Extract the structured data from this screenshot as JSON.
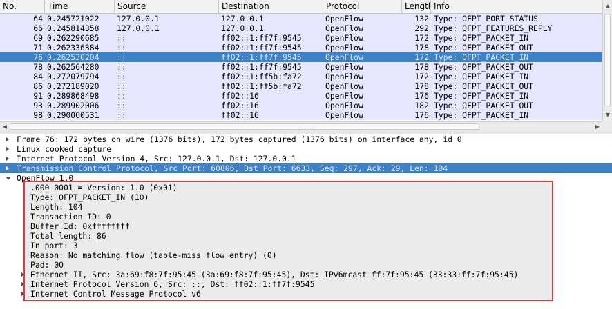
{
  "packet_list": {
    "columns": [
      "No.",
      "Time",
      "Source",
      "Destination",
      "Protocol",
      "Length",
      "Info"
    ],
    "rows": [
      {
        "no": "64",
        "time": "0.245721022",
        "src": "127.0.0.1",
        "dst": "127.0.0.1",
        "proto": "OpenFlow",
        "len": "132",
        "info": "Type: OFPT_PORT_STATUS"
      },
      {
        "no": "66",
        "time": "0.245814358",
        "src": "127.0.0.1",
        "dst": "127.0.0.1",
        "proto": "OpenFlow",
        "len": "292",
        "info": "Type: OFPT_FEATURES_REPLY"
      },
      {
        "no": "69",
        "time": "0.262290685",
        "src": "::",
        "dst": "ff02::1:ff7f:9545",
        "proto": "OpenFlow",
        "len": "172",
        "info": "Type: OFPT_PACKET_IN"
      },
      {
        "no": "71",
        "time": "0.262336384",
        "src": "::",
        "dst": "ff02::1:ff7f:9545",
        "proto": "OpenFlow",
        "len": "178",
        "info": "Type: OFPT_PACKET_OUT"
      },
      {
        "no": "76",
        "time": "0.262530204",
        "src": "::",
        "dst": "ff02::1:ff7f:9545",
        "proto": "OpenFlow",
        "len": "172",
        "info": "Type: OFPT_PACKET_IN"
      },
      {
        "no": "78",
        "time": "0.262564280",
        "src": "::",
        "dst": "ff02::1:ff7f:9545",
        "proto": "OpenFlow",
        "len": "178",
        "info": "Type: OFPT_PACKET_OUT"
      },
      {
        "no": "84",
        "time": "0.272079794",
        "src": "::",
        "dst": "ff02::1:ff5b:fa72",
        "proto": "OpenFlow",
        "len": "172",
        "info": "Type: OFPT_PACKET_IN"
      },
      {
        "no": "86",
        "time": "0.272189020",
        "src": "::",
        "dst": "ff02::1:ff5b:fa72",
        "proto": "OpenFlow",
        "len": "178",
        "info": "Type: OFPT_PACKET_OUT"
      },
      {
        "no": "91",
        "time": "0.289868498",
        "src": "::",
        "dst": "ff02::16",
        "proto": "OpenFlow",
        "len": "176",
        "info": "Type: OFPT_PACKET_IN"
      },
      {
        "no": "93",
        "time": "0.289902006",
        "src": "::",
        "dst": "ff02::16",
        "proto": "OpenFlow",
        "len": "182",
        "info": "Type: OFPT_PACKET_OUT"
      },
      {
        "no": "98",
        "time": "0.290060531",
        "src": "::",
        "dst": "ff02::16",
        "proto": "OpenFlow",
        "len": "176",
        "info": "Type: OFPT_PACKET_IN"
      }
    ],
    "selected_no": "76"
  },
  "details": {
    "rows": [
      {
        "text": "Frame 76: 172 bytes on wire (1376 bits), 172 bytes captured (1376 bits) on interface any, id 0",
        "expander": "collapsed"
      },
      {
        "text": "Linux cooked capture",
        "expander": "collapsed"
      },
      {
        "text": "Internet Protocol Version 4, Src: 127.0.0.1, Dst: 127.0.0.1",
        "expander": "collapsed"
      },
      {
        "text": "Transmission Control Protocol, Src Port: 60806, Dst Port: 6633, Seq: 297, Ack: 29, Len: 104",
        "expander": "collapsed",
        "selected": true
      },
      {
        "text": "OpenFlow 1.0",
        "expander": "expanded"
      },
      {
        "text": ".000 0001 = Version: 1.0 (0x01)"
      },
      {
        "text": "Type: OFPT_PACKET_IN (10)"
      },
      {
        "text": "Length: 104"
      },
      {
        "text": "Transaction ID: 0"
      },
      {
        "text": "Buffer Id: 0xffffffff"
      },
      {
        "text": "Total length: 86"
      },
      {
        "text": "In port: 3"
      },
      {
        "text": "Reason: No matching flow (table-miss flow entry) (0)"
      },
      {
        "text": "Pad: 00"
      },
      {
        "text": "Ethernet II, Src: 3a:69:f8:7f:95:45 (3a:69:f8:7f:95:45), Dst: IPv6mcast_ff:7f:95:45 (33:33:ff:7f:95:45)",
        "expander": "collapsed"
      },
      {
        "text": "Internet Protocol Version 6, Src: ::, Dst: ff02::1:ff7f:9545",
        "expander": "collapsed"
      },
      {
        "text": "Internet Control Message Protocol v6",
        "expander": "collapsed"
      }
    ]
  },
  "icons": {
    "scroll_up": "scroll-up-arrow-icon",
    "scroll_down": "scroll-down-arrow-icon",
    "scroll_left": "scroll-left-arrow-icon",
    "scroll_right": "scroll-right-arrow-icon",
    "expand": "expand-triangle-icon",
    "collapse": "collapse-triangle-icon"
  },
  "colors": {
    "row_bg": "#e7e6ff",
    "selected_bg": "#3c82c8",
    "highlight_box": "#e53935"
  }
}
